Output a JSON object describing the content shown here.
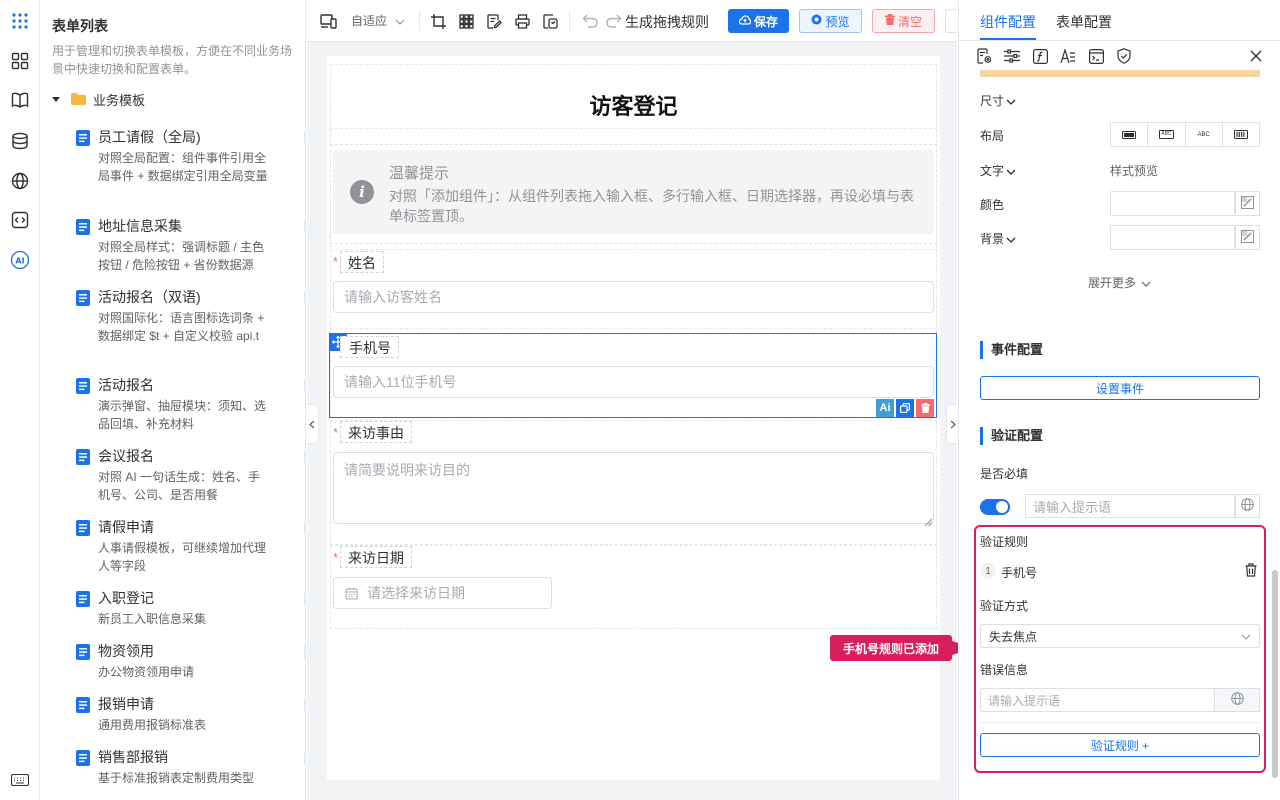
{
  "sidebar": {
    "title": "表单列表",
    "description": "用于管理和切换表单模板，方便在不同业务场景中快速切换和配置表单。",
    "category": "业务模板",
    "templates": [
      {
        "name": "员工请假（全局)",
        "desc": "对照全局配置：组件事件引用全局事件 + 数据绑定引用全局变量"
      },
      {
        "name": "地址信息采集",
        "desc": "对照全局样式：强调标题 / 主色按钮 / 危险按钮 + 省份数据源"
      },
      {
        "name": "活动报名（双语)",
        "desc": "对照国际化：语言图标选词条 + 数据绑定 $t + 自定义校验 api.t"
      },
      {
        "name": "活动报名",
        "desc": "演示弹窗、抽屉模块：须知、选品回填、补充材料"
      },
      {
        "name": "会议报名",
        "desc": "对照 AI 一句话生成：姓名、手机号、公司、是否用餐"
      },
      {
        "name": "请假申请",
        "desc": "人事请假模板，可继续增加代理人等字段"
      },
      {
        "name": "入职登记",
        "desc": "新员工入职信息采集"
      },
      {
        "name": "物资领用",
        "desc": "办公物资领用申请"
      },
      {
        "name": "报销申请",
        "desc": "通用费用报销标准表"
      },
      {
        "name": "销售部报销",
        "desc": "基于标准报销表定制费用类型"
      }
    ]
  },
  "toolbar": {
    "layout_mode": "自适应",
    "generate_rule": "生成拖拽规则",
    "save": "保存",
    "preview": "预览",
    "clear": "清空"
  },
  "form": {
    "title": "访客登记",
    "tip_title": "温馨提示",
    "tip_text": "对照「添加组件」：从组件列表拖入输入框、多行输入框、日期选择器，再设必填与表单标签置顶。",
    "fields": {
      "name": {
        "label": "姓名",
        "placeholder": "请输入访客姓名",
        "required": true
      },
      "phone": {
        "label": "手机号",
        "placeholder": "请输入11位手机号",
        "required": false
      },
      "reason": {
        "label": "来访事由",
        "placeholder": "请简要说明来访目的",
        "required": true
      },
      "date": {
        "label": "来访日期",
        "placeholder": "请选择来访日期",
        "required": true
      }
    },
    "ai_badge": "Ai"
  },
  "panel": {
    "tabs": [
      "组件配置",
      "表单配置"
    ],
    "active_tab": 0,
    "size_label": "尺寸",
    "layout_label": "布局",
    "layout_options": [
      "",
      "ABC",
      "ABC",
      ""
    ],
    "text_label": "文字",
    "style_preview": "样式预览",
    "color_label": "颜色",
    "bg_label": "背景",
    "expand_more": "展开更多",
    "event_title": "事件配置",
    "set_event": "设置事件",
    "validation_title": "验证配置",
    "required_label": "是否必填",
    "required_on": true,
    "required_placeholder": "请输入提示语",
    "rules_title": "验证规则",
    "rule_index": "1",
    "rule_name": "手机号",
    "trigger_label": "验证方式",
    "trigger_value": "失去焦点",
    "error_label": "错误信息",
    "error_placeholder": "请输入提示语",
    "add_rule": "验证规则 +",
    "callout": "手机号规则已添加"
  },
  "colors": {
    "primary": "#1a73e8",
    "danger": "#f56c6c",
    "highlight": "#d81e5b",
    "accent_bar": "#f5d5a3"
  }
}
